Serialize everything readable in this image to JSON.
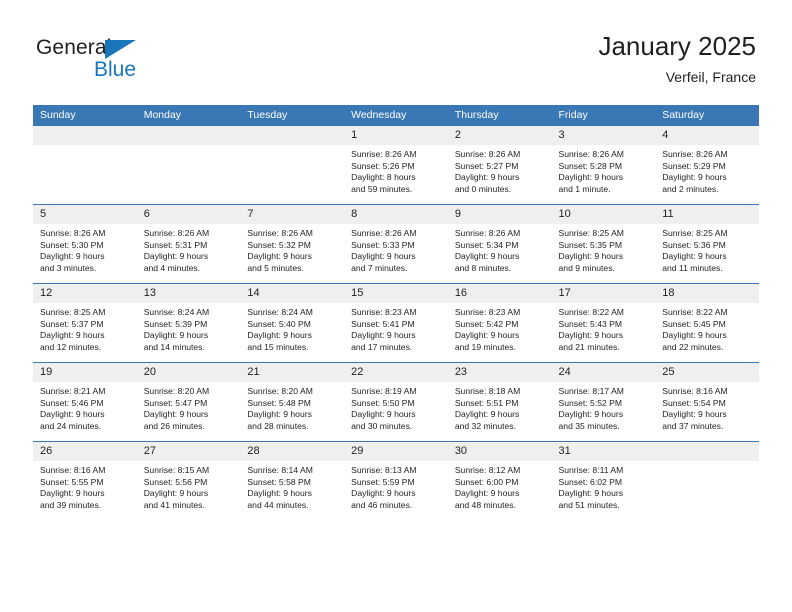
{
  "brand": {
    "name_part1": "General",
    "name_part2": "Blue",
    "accent_color": "#1a75bb"
  },
  "header": {
    "title": "January 2025",
    "subtitle": "Verfeil, France",
    "header_bg_color": "#3a78b5",
    "daynum_bg_color": "#efefef"
  },
  "weekdays": [
    "Sunday",
    "Monday",
    "Tuesday",
    "Wednesday",
    "Thursday",
    "Friday",
    "Saturday"
  ],
  "labels": {
    "sunrise": "Sunrise:",
    "sunset": "Sunset:",
    "daylight": "Daylight:"
  },
  "weeks": [
    [
      {
        "day": "",
        "sunrise": "",
        "sunset": "",
        "daylight_1": "",
        "daylight_2": "",
        "blank": true
      },
      {
        "day": "",
        "sunrise": "",
        "sunset": "",
        "daylight_1": "",
        "daylight_2": "",
        "blank": true
      },
      {
        "day": "",
        "sunrise": "",
        "sunset": "",
        "daylight_1": "",
        "daylight_2": "",
        "blank": true
      },
      {
        "day": "1",
        "sunrise": "Sunrise: 8:26 AM",
        "sunset": "Sunset: 5:26 PM",
        "daylight_1": "Daylight: 8 hours",
        "daylight_2": "and 59 minutes.",
        "blank": false
      },
      {
        "day": "2",
        "sunrise": "Sunrise: 8:26 AM",
        "sunset": "Sunset: 5:27 PM",
        "daylight_1": "Daylight: 9 hours",
        "daylight_2": "and 0 minutes.",
        "blank": false
      },
      {
        "day": "3",
        "sunrise": "Sunrise: 8:26 AM",
        "sunset": "Sunset: 5:28 PM",
        "daylight_1": "Daylight: 9 hours",
        "daylight_2": "and 1 minute.",
        "blank": false
      },
      {
        "day": "4",
        "sunrise": "Sunrise: 8:26 AM",
        "sunset": "Sunset: 5:29 PM",
        "daylight_1": "Daylight: 9 hours",
        "daylight_2": "and 2 minutes.",
        "blank": false
      }
    ],
    [
      {
        "day": "5",
        "sunrise": "Sunrise: 8:26 AM",
        "sunset": "Sunset: 5:30 PM",
        "daylight_1": "Daylight: 9 hours",
        "daylight_2": "and 3 minutes.",
        "blank": false
      },
      {
        "day": "6",
        "sunrise": "Sunrise: 8:26 AM",
        "sunset": "Sunset: 5:31 PM",
        "daylight_1": "Daylight: 9 hours",
        "daylight_2": "and 4 minutes.",
        "blank": false
      },
      {
        "day": "7",
        "sunrise": "Sunrise: 8:26 AM",
        "sunset": "Sunset: 5:32 PM",
        "daylight_1": "Daylight: 9 hours",
        "daylight_2": "and 5 minutes.",
        "blank": false
      },
      {
        "day": "8",
        "sunrise": "Sunrise: 8:26 AM",
        "sunset": "Sunset: 5:33 PM",
        "daylight_1": "Daylight: 9 hours",
        "daylight_2": "and 7 minutes.",
        "blank": false
      },
      {
        "day": "9",
        "sunrise": "Sunrise: 8:26 AM",
        "sunset": "Sunset: 5:34 PM",
        "daylight_1": "Daylight: 9 hours",
        "daylight_2": "and 8 minutes.",
        "blank": false
      },
      {
        "day": "10",
        "sunrise": "Sunrise: 8:25 AM",
        "sunset": "Sunset: 5:35 PM",
        "daylight_1": "Daylight: 9 hours",
        "daylight_2": "and 9 minutes.",
        "blank": false
      },
      {
        "day": "11",
        "sunrise": "Sunrise: 8:25 AM",
        "sunset": "Sunset: 5:36 PM",
        "daylight_1": "Daylight: 9 hours",
        "daylight_2": "and 11 minutes.",
        "blank": false
      }
    ],
    [
      {
        "day": "12",
        "sunrise": "Sunrise: 8:25 AM",
        "sunset": "Sunset: 5:37 PM",
        "daylight_1": "Daylight: 9 hours",
        "daylight_2": "and 12 minutes.",
        "blank": false
      },
      {
        "day": "13",
        "sunrise": "Sunrise: 8:24 AM",
        "sunset": "Sunset: 5:39 PM",
        "daylight_1": "Daylight: 9 hours",
        "daylight_2": "and 14 minutes.",
        "blank": false
      },
      {
        "day": "14",
        "sunrise": "Sunrise: 8:24 AM",
        "sunset": "Sunset: 5:40 PM",
        "daylight_1": "Daylight: 9 hours",
        "daylight_2": "and 15 minutes.",
        "blank": false
      },
      {
        "day": "15",
        "sunrise": "Sunrise: 8:23 AM",
        "sunset": "Sunset: 5:41 PM",
        "daylight_1": "Daylight: 9 hours",
        "daylight_2": "and 17 minutes.",
        "blank": false
      },
      {
        "day": "16",
        "sunrise": "Sunrise: 8:23 AM",
        "sunset": "Sunset: 5:42 PM",
        "daylight_1": "Daylight: 9 hours",
        "daylight_2": "and 19 minutes.",
        "blank": false
      },
      {
        "day": "17",
        "sunrise": "Sunrise: 8:22 AM",
        "sunset": "Sunset: 5:43 PM",
        "daylight_1": "Daylight: 9 hours",
        "daylight_2": "and 21 minutes.",
        "blank": false
      },
      {
        "day": "18",
        "sunrise": "Sunrise: 8:22 AM",
        "sunset": "Sunset: 5:45 PM",
        "daylight_1": "Daylight: 9 hours",
        "daylight_2": "and 22 minutes.",
        "blank": false
      }
    ],
    [
      {
        "day": "19",
        "sunrise": "Sunrise: 8:21 AM",
        "sunset": "Sunset: 5:46 PM",
        "daylight_1": "Daylight: 9 hours",
        "daylight_2": "and 24 minutes.",
        "blank": false
      },
      {
        "day": "20",
        "sunrise": "Sunrise: 8:20 AM",
        "sunset": "Sunset: 5:47 PM",
        "daylight_1": "Daylight: 9 hours",
        "daylight_2": "and 26 minutes.",
        "blank": false
      },
      {
        "day": "21",
        "sunrise": "Sunrise: 8:20 AM",
        "sunset": "Sunset: 5:48 PM",
        "daylight_1": "Daylight: 9 hours",
        "daylight_2": "and 28 minutes.",
        "blank": false
      },
      {
        "day": "22",
        "sunrise": "Sunrise: 8:19 AM",
        "sunset": "Sunset: 5:50 PM",
        "daylight_1": "Daylight: 9 hours",
        "daylight_2": "and 30 minutes.",
        "blank": false
      },
      {
        "day": "23",
        "sunrise": "Sunrise: 8:18 AM",
        "sunset": "Sunset: 5:51 PM",
        "daylight_1": "Daylight: 9 hours",
        "daylight_2": "and 32 minutes.",
        "blank": false
      },
      {
        "day": "24",
        "sunrise": "Sunrise: 8:17 AM",
        "sunset": "Sunset: 5:52 PM",
        "daylight_1": "Daylight: 9 hours",
        "daylight_2": "and 35 minutes.",
        "blank": false
      },
      {
        "day": "25",
        "sunrise": "Sunrise: 8:16 AM",
        "sunset": "Sunset: 5:54 PM",
        "daylight_1": "Daylight: 9 hours",
        "daylight_2": "and 37 minutes.",
        "blank": false
      }
    ],
    [
      {
        "day": "26",
        "sunrise": "Sunrise: 8:16 AM",
        "sunset": "Sunset: 5:55 PM",
        "daylight_1": "Daylight: 9 hours",
        "daylight_2": "and 39 minutes.",
        "blank": false
      },
      {
        "day": "27",
        "sunrise": "Sunrise: 8:15 AM",
        "sunset": "Sunset: 5:56 PM",
        "daylight_1": "Daylight: 9 hours",
        "daylight_2": "and 41 minutes.",
        "blank": false
      },
      {
        "day": "28",
        "sunrise": "Sunrise: 8:14 AM",
        "sunset": "Sunset: 5:58 PM",
        "daylight_1": "Daylight: 9 hours",
        "daylight_2": "and 44 minutes.",
        "blank": false
      },
      {
        "day": "29",
        "sunrise": "Sunrise: 8:13 AM",
        "sunset": "Sunset: 5:59 PM",
        "daylight_1": "Daylight: 9 hours",
        "daylight_2": "and 46 minutes.",
        "blank": false
      },
      {
        "day": "30",
        "sunrise": "Sunrise: 8:12 AM",
        "sunset": "Sunset: 6:00 PM",
        "daylight_1": "Daylight: 9 hours",
        "daylight_2": "and 48 minutes.",
        "blank": false
      },
      {
        "day": "31",
        "sunrise": "Sunrise: 8:11 AM",
        "sunset": "Sunset: 6:02 PM",
        "daylight_1": "Daylight: 9 hours",
        "daylight_2": "and 51 minutes.",
        "blank": false
      },
      {
        "day": "",
        "sunrise": "",
        "sunset": "",
        "daylight_1": "",
        "daylight_2": "",
        "blank": true
      }
    ]
  ]
}
